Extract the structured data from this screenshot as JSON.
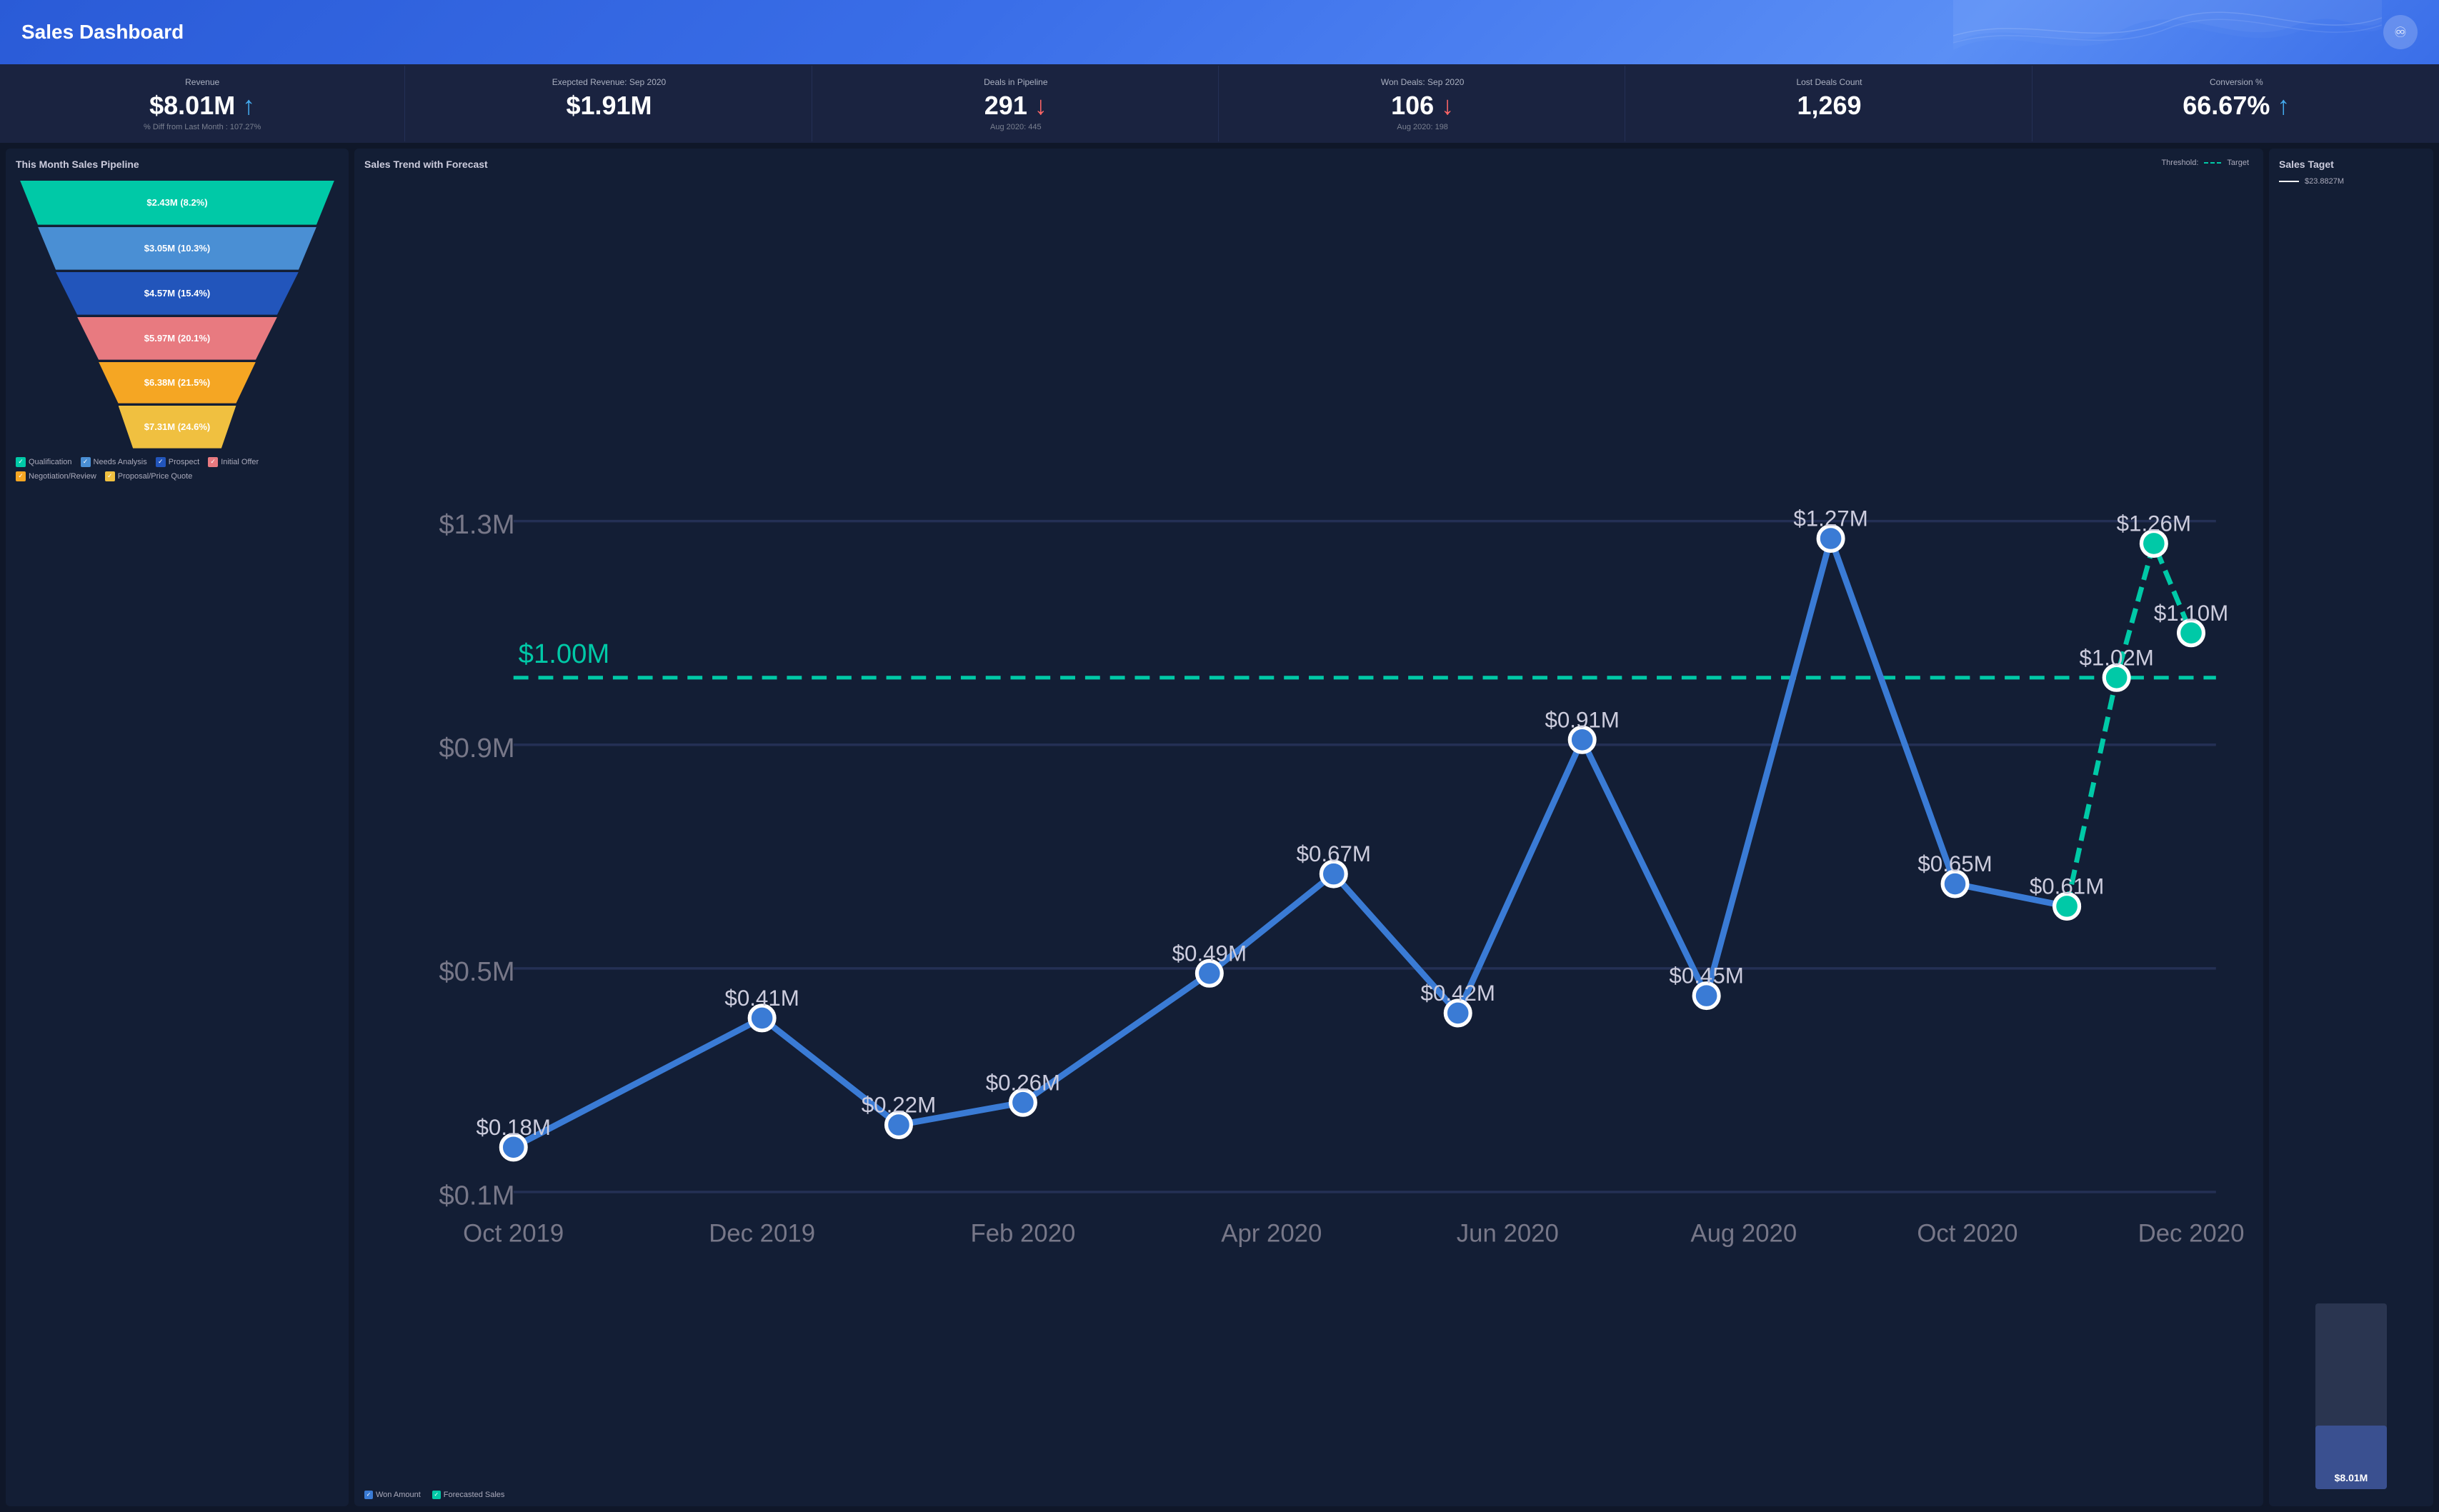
{
  "header": {
    "title": "Sales Dashboard",
    "logo_symbol": "♾"
  },
  "kpi": [
    {
      "label": "Revenue",
      "value": "$8.01M",
      "arrow": "up",
      "sub": "% Diff from Last Month : 107.27%"
    },
    {
      "label": "Exepcted Revenue: Sep 2020",
      "value": "$1.91M",
      "arrow": null,
      "sub": null
    },
    {
      "label": "Deals in Pipeline",
      "value": "291",
      "arrow": "down",
      "sub": "Aug 2020: 445"
    },
    {
      "label": "Won Deals: Sep 2020",
      "value": "106",
      "arrow": "down",
      "sub": "Aug 2020: 198"
    },
    {
      "label": "Lost Deals Count",
      "value": "1,269",
      "arrow": null,
      "sub": null
    },
    {
      "label": "Conversion %",
      "value": "66.67%",
      "arrow": "up",
      "sub": null
    }
  ],
  "funnel": {
    "title": "This Month Sales Pipeline",
    "segments": [
      {
        "label": "$2.43M (8.2%)",
        "color": "#00c9a7",
        "widthPct": 100,
        "clipTop": 95,
        "clipBot": 84
      },
      {
        "label": "$3.05M (10.3%)",
        "color": "#4a8fd4",
        "widthPct": 88,
        "clipTop": 95,
        "clipBot": 82
      },
      {
        "label": "$4.57M (15.4%)",
        "color": "#2255bb",
        "widthPct": 76,
        "clipTop": 95,
        "clipBot": 80
      },
      {
        "label": "$5.97M (20.1%)",
        "color": "#e87a80",
        "widthPct": 62,
        "clipTop": 95,
        "clipBot": 77
      },
      {
        "label": "$6.38M (21.5%)",
        "color": "#f5a623",
        "widthPct": 48,
        "clipTop": 95,
        "clipBot": 74
      },
      {
        "label": "$7.31M (24.6%)",
        "color": "#f0c040",
        "widthPct": 36,
        "clipTop": 95,
        "clipBot": 70
      }
    ],
    "legend": [
      {
        "label": "Qualification",
        "color": "#00c9a7"
      },
      {
        "label": "Needs Analysis",
        "color": "#4a8fd4"
      },
      {
        "label": "Prospect",
        "color": "#2255bb"
      },
      {
        "label": "Initial Offer",
        "color": "#e87a80"
      },
      {
        "label": "Negotiation/Review",
        "color": "#f5a623"
      },
      {
        "label": "Proposal/Price Quote",
        "color": "#f0c040"
      }
    ]
  },
  "chart": {
    "title": "Sales Trend with Forecast",
    "threshold_label": "Threshold:",
    "target_label": "Target",
    "threshold_value": "$1.00M",
    "x_labels": [
      "Oct 2019",
      "Dec 2019",
      "Feb 2020",
      "Apr 2020",
      "Jun 2020",
      "Aug 2020",
      "Oct 2020",
      "Dec 2020"
    ],
    "y_labels": [
      "$0.1M",
      "$0.5M",
      "$0.9M",
      "$1.3M"
    ],
    "data_points": [
      {
        "x": 0,
        "y": 0.18,
        "label": "$0.18M"
      },
      {
        "x": 0.14,
        "y": 0.41,
        "label": "$0.41M"
      },
      {
        "x": 0.21,
        "y": 0.22,
        "label": "$0.22M"
      },
      {
        "x": 0.28,
        "y": 0.26,
        "label": "$0.26M"
      },
      {
        "x": 0.35,
        "y": 0.49,
        "label": "$0.49M"
      },
      {
        "x": 0.43,
        "y": 0.67,
        "label": "$0.67M"
      },
      {
        "x": 0.5,
        "y": 0.42,
        "label": "$0.42M"
      },
      {
        "x": 0.57,
        "y": 0.91,
        "label": "$0.91M"
      },
      {
        "x": 0.64,
        "y": 0.45,
        "label": "$0.45M"
      },
      {
        "x": 0.71,
        "y": 1.27,
        "label": "$1.27M"
      },
      {
        "x": 0.78,
        "y": 0.65,
        "label": "$0.65M"
      },
      {
        "x": 0.85,
        "y": 0.61,
        "label": "$0.61M"
      }
    ],
    "forecast_points": [
      {
        "x": 0.85,
        "y": 0.61,
        "label": "$0.61M"
      },
      {
        "x": 0.9,
        "y": 1.02,
        "label": "$1.02M"
      },
      {
        "x": 0.95,
        "y": 1.26,
        "label": "$1.26M"
      },
      {
        "x": 1.0,
        "y": 1.1,
        "label": "$1.10M"
      }
    ],
    "legend": [
      {
        "label": "Won Amount",
        "color": "#3a7bd5"
      },
      {
        "label": "Forecasted Sales",
        "color": "#00c9a7"
      }
    ]
  },
  "target": {
    "title": "Sales Taget",
    "target_line_value": "$23.8827M",
    "current_value": "$8.01M",
    "fill_pct": 34
  }
}
